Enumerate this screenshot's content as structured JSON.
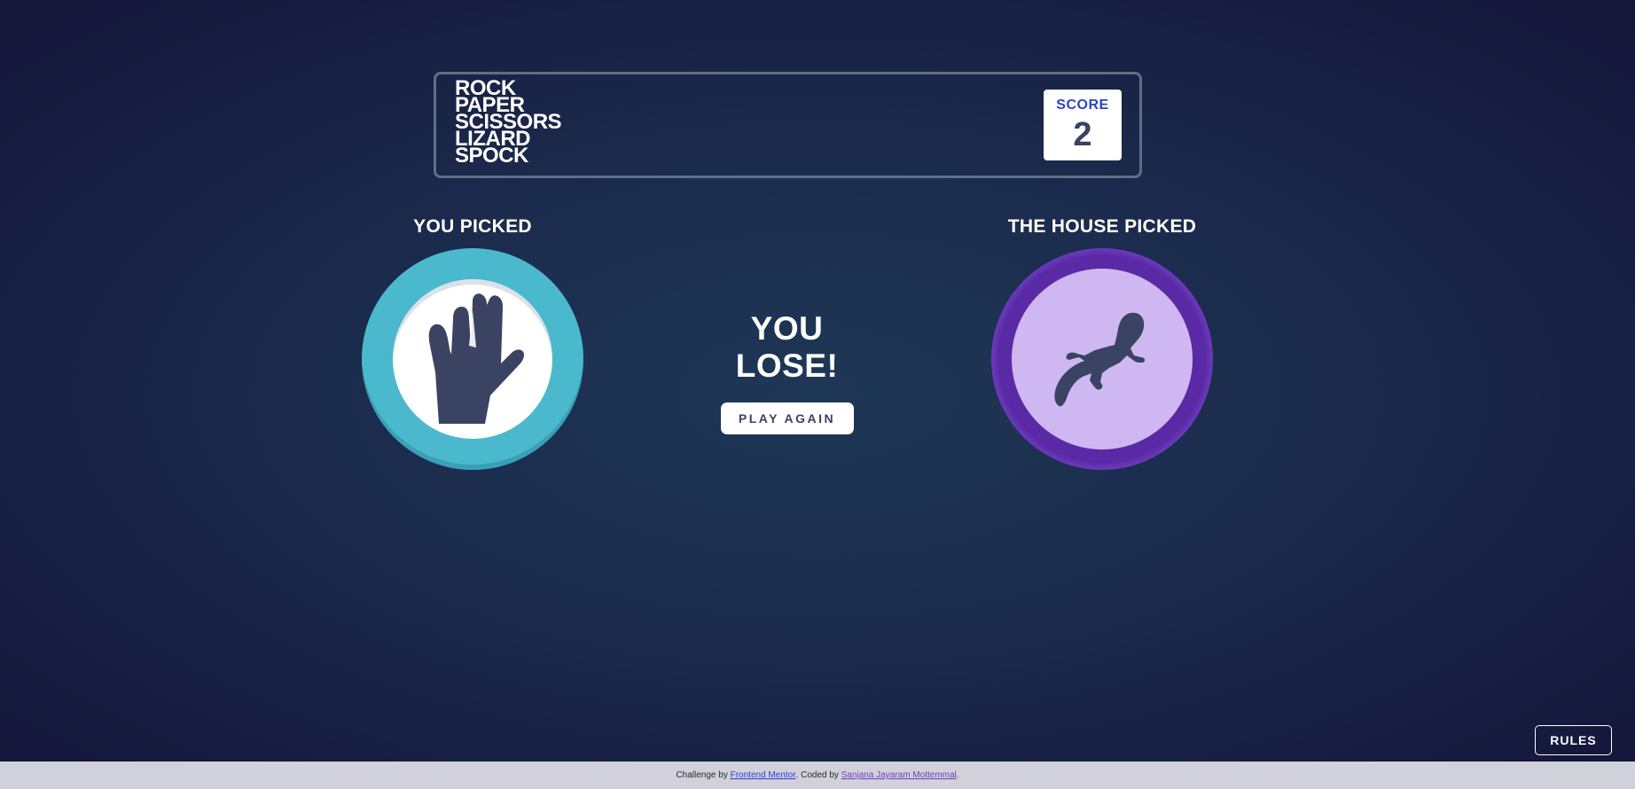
{
  "header": {
    "title_lines": [
      "ROCK",
      "PAPER",
      "SCISSORS",
      "LIZARD",
      "SPOCK"
    ],
    "score_label": "SCORE",
    "score_value": "2"
  },
  "game": {
    "player_label": "YOU PICKED",
    "house_label": "THE HOUSE PICKED",
    "player_choice_icon": "spock-hand-icon",
    "house_choice_icon": "lizard-icon",
    "result_text": "YOU LOSE!",
    "play_again_label": "PLAY AGAIN"
  },
  "rules_label": "RULES",
  "footer": {
    "prefix": "Challenge by ",
    "link1": "Frontend Mentor",
    "middle": ". Coded by ",
    "link2": "Sanjana Jayaram Mottemmal",
    "suffix": "."
  },
  "colors": {
    "spock": "#4bb9cd",
    "lizard": "#8c5de5",
    "score_label": "#2a46c0",
    "dark_text": "#3b4363"
  }
}
